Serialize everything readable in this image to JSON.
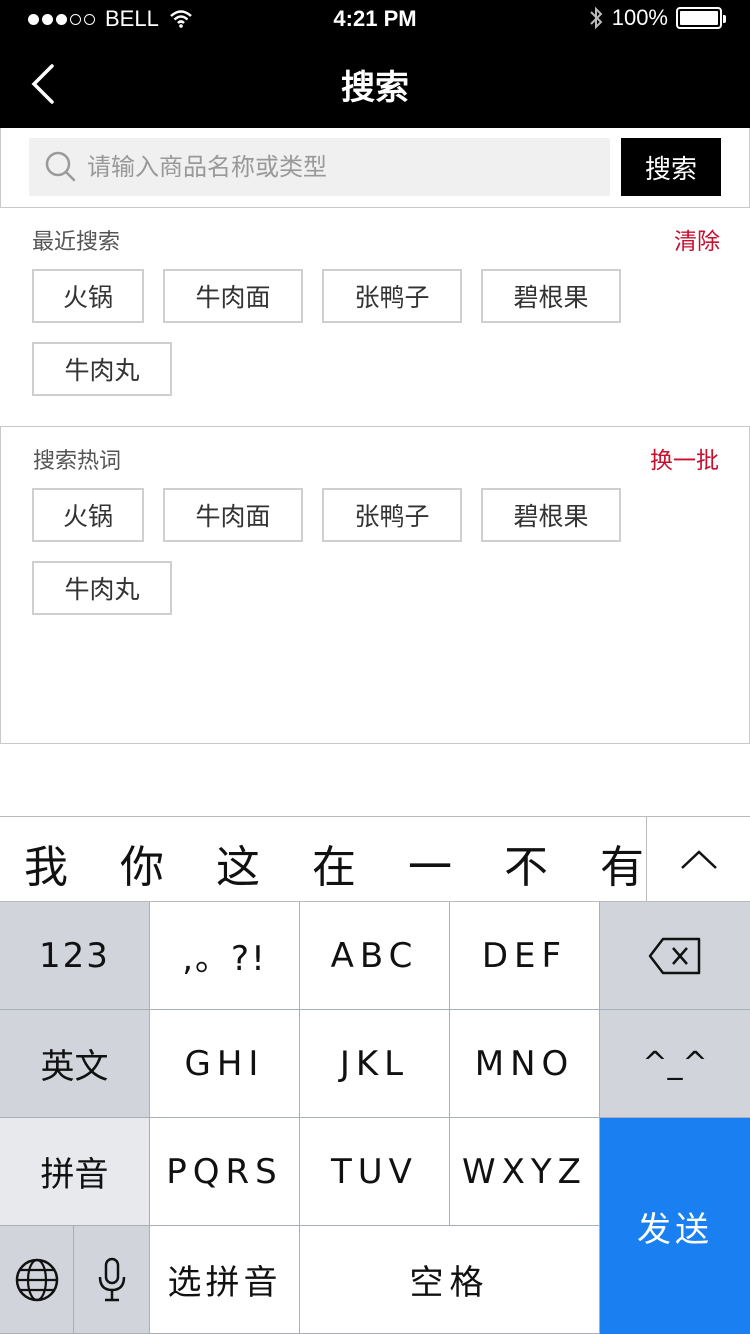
{
  "status": {
    "carrier": "BELL",
    "time": "4:21 PM",
    "battery": "100%"
  },
  "nav": {
    "title": "搜索"
  },
  "search": {
    "placeholder": "请输入商品名称或类型",
    "button": "搜索"
  },
  "recent": {
    "title": "最近搜索",
    "action": "清除",
    "tags": [
      "火锅",
      "牛肉面",
      "张鸭子",
      "碧根果",
      "牛肉丸"
    ]
  },
  "hot": {
    "title": "搜索热词",
    "action": "换一批",
    "tags": [
      "火锅",
      "牛肉面",
      "张鸭子",
      "碧根果",
      "牛肉丸"
    ]
  },
  "keyboard": {
    "candidates": [
      "我",
      "你",
      "这",
      "在",
      "一",
      "不",
      "有"
    ],
    "row1": [
      "123",
      ",。?!",
      "ABC",
      "DEF"
    ],
    "row2": [
      "英文",
      "GHI",
      "JKL",
      "MNO",
      "^_^"
    ],
    "row3": [
      "拼音",
      "PQRS",
      "TUV",
      "WXYZ"
    ],
    "row4": [
      "选拼音",
      "空格"
    ],
    "send": "发送"
  }
}
